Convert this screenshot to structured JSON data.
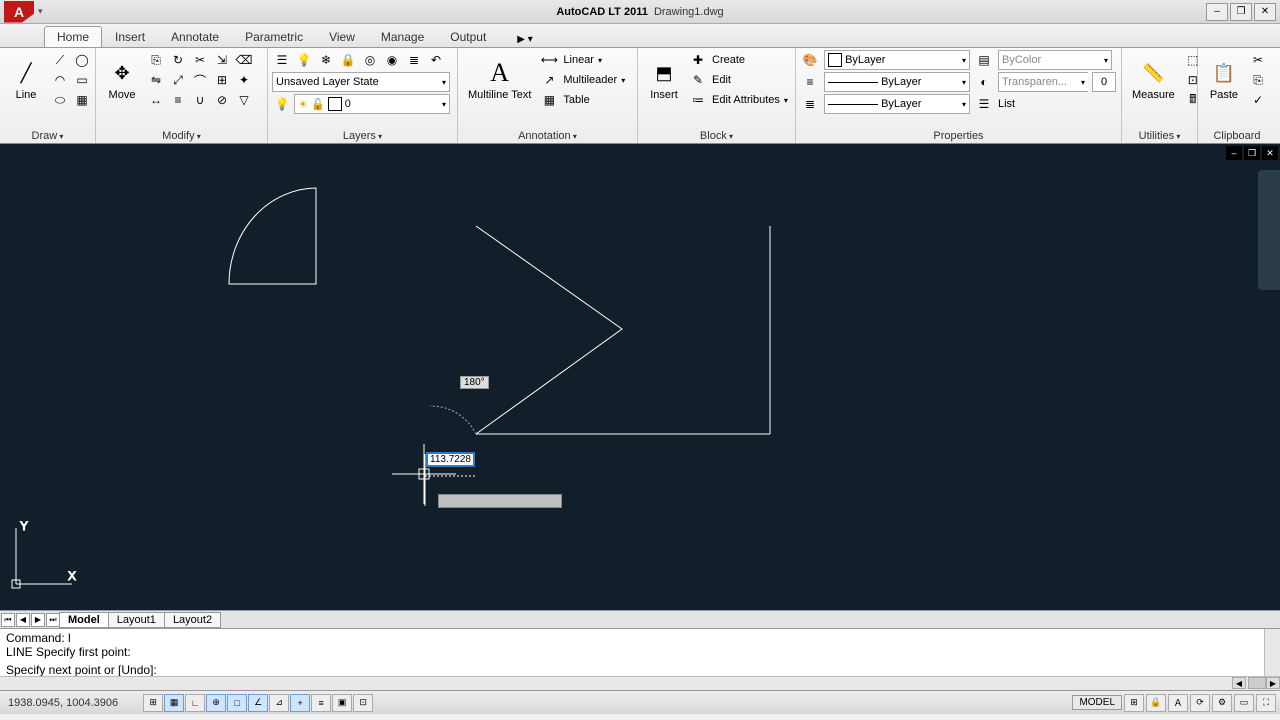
{
  "title": {
    "app": "AutoCAD LT 2011",
    "file": "Drawing1.dwg"
  },
  "window_controls": {
    "min": "–",
    "max": "❐",
    "close": "✕"
  },
  "tabs": [
    "Home",
    "Insert",
    "Annotate",
    "Parametric",
    "View",
    "Manage",
    "Output"
  ],
  "active_tab": "Home",
  "panels": {
    "draw": {
      "title": "Draw",
      "line_label": "Line"
    },
    "modify": {
      "title": "Modify",
      "move_label": "Move"
    },
    "layers": {
      "title": "Layers",
      "state": "Unsaved Layer State",
      "current": "0"
    },
    "annotation": {
      "title": "Annotation",
      "mtext": "Multiline Text",
      "linear": "Linear",
      "mleader": "Multileader",
      "table": "Table"
    },
    "block": {
      "title": "Block",
      "insert": "Insert",
      "create": "Create",
      "edit": "Edit",
      "editattr": "Edit Attributes"
    },
    "properties": {
      "title": "Properties",
      "color": "ByLayer",
      "lt": "ByLayer",
      "lw": "ByLayer",
      "pcolor": "ByColor",
      "transp": "Transparen...",
      "transpval": "0",
      "list": "List"
    },
    "utilities": {
      "title": "Utilities",
      "measure": "Measure"
    },
    "clipboard": {
      "title": "Clipboard",
      "paste": "Paste"
    }
  },
  "drawing": {
    "angle": "180°",
    "dynamic_input": "113.7228"
  },
  "layout_tabs": [
    "Model",
    "Layout1",
    "Layout2"
  ],
  "active_layout": "Model",
  "command": {
    "line1": "Command: l",
    "line2": "LINE Specify first point:",
    "line3": "Specify next point or [Undo]:"
  },
  "status": {
    "coords": "1938.0945, 1004.3906",
    "model": "MODEL"
  }
}
